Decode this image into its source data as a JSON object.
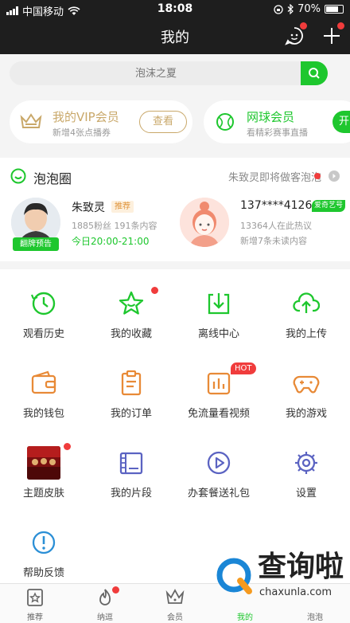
{
  "status_bar": {
    "carrier": "中国移动",
    "time": "18:08",
    "battery": "70%"
  },
  "header": {
    "title": "我的"
  },
  "search": {
    "placeholder": "泡沫之夏"
  },
  "vip_cards": [
    {
      "title": "我的VIP会员",
      "subtitle": "新增4张点播券",
      "button": "查看"
    },
    {
      "title": "网球会员",
      "subtitle": "看精彩赛事直播",
      "button": "开"
    }
  ],
  "bubble_circle": {
    "title": "泡泡圈",
    "notice": "朱致灵即将做客泡泡",
    "items": [
      {
        "name": "朱致灵",
        "tag": "推荐",
        "stats": "1885粉丝 191条内容",
        "schedule": "今日20:00-21:00",
        "badge": "翻牌预告"
      },
      {
        "name": "137****4126",
        "tag": "爱奇艺号",
        "stats": "13364人在此热议",
        "extra": "新增7条未读内容"
      }
    ]
  },
  "grid_items": [
    {
      "label": "观看历史",
      "icon": "clock-icon"
    },
    {
      "label": "我的收藏",
      "icon": "star-icon"
    },
    {
      "label": "离线中心",
      "icon": "download-icon"
    },
    {
      "label": "我的上传",
      "icon": "cloud-upload-icon"
    },
    {
      "label": "我的钱包",
      "icon": "wallet-icon"
    },
    {
      "label": "我的订单",
      "icon": "order-icon"
    },
    {
      "label": "免流量看视频",
      "icon": "data-free-icon",
      "badge": "HOT"
    },
    {
      "label": "我的游戏",
      "icon": "gamepad-icon"
    },
    {
      "label": "主题皮肤",
      "icon": "theme-thumbnail"
    },
    {
      "label": "我的片段",
      "icon": "film-clip-icon"
    },
    {
      "label": "办套餐送礼包",
      "icon": "play-circle-icon"
    },
    {
      "label": "设置",
      "icon": "gear-icon"
    },
    {
      "label": "帮助反馈",
      "icon": "help-icon"
    }
  ],
  "tabbar": [
    {
      "label": "推荐",
      "icon": "recommend-icon"
    },
    {
      "label": "纳逗",
      "icon": "fire-icon"
    },
    {
      "label": "会员",
      "icon": "crown-icon"
    },
    {
      "label": "我的",
      "icon": "profile-icon"
    },
    {
      "label": "泡泡",
      "icon": "bubble-icon"
    }
  ],
  "watermark": {
    "brand": "查询啦",
    "url": "chaxunla.com"
  },
  "colors": {
    "accent": "#1ec72e",
    "gold": "#c9a86a",
    "red_dot": "#f03c3c",
    "header_bg": "#1e1e1e"
  }
}
